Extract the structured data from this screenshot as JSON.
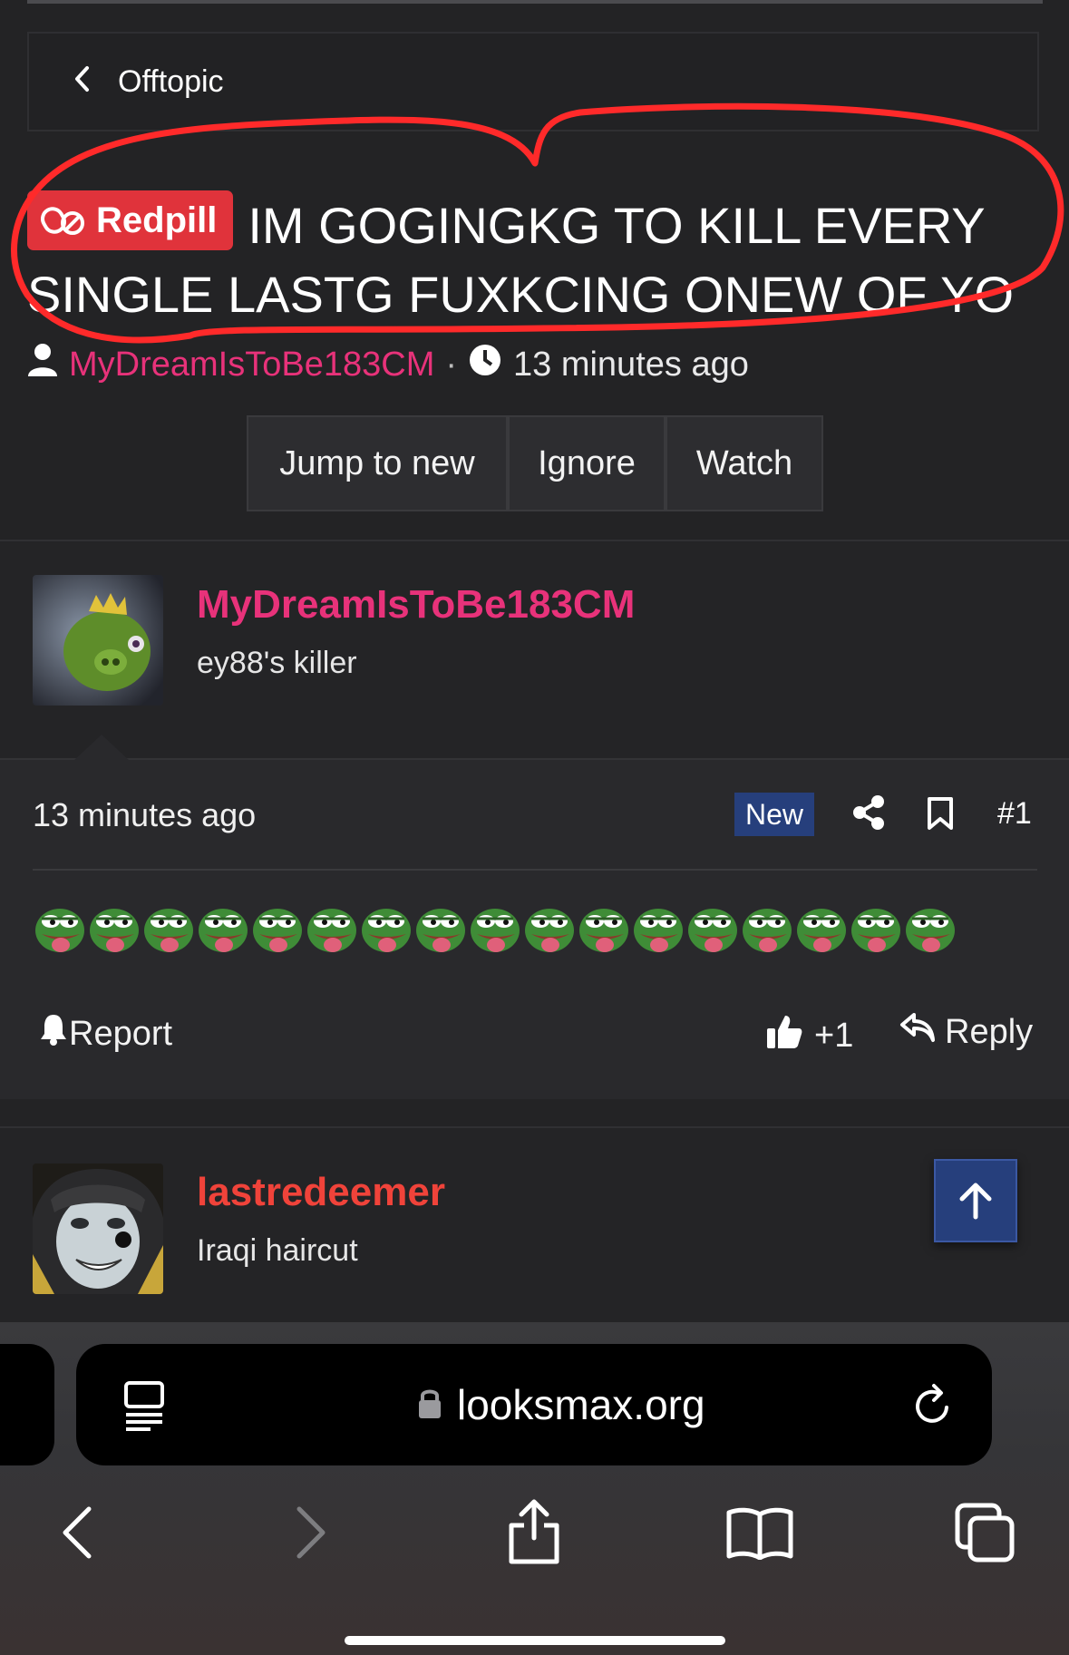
{
  "breadcrumb": {
    "label": "Offtopic"
  },
  "thread": {
    "prefix": "Redpill",
    "title": "IM GOGINGKG TO KILL EVERY SINGLE LASTG FUXKCING ONEW OF YO",
    "author": "MyDreamIsToBe183CM",
    "time": "13 minutes ago"
  },
  "actions": {
    "jump": "Jump to new",
    "ignore": "Ignore",
    "watch": "Watch"
  },
  "post1": {
    "username": "MyDreamIsToBe183CM",
    "user_title": "ey88's killer",
    "time": "13 minutes ago",
    "new_badge": "New",
    "post_number": "#1",
    "emoji_count": 17,
    "report": "Report",
    "like_count": "+1",
    "reply": "Reply"
  },
  "post2": {
    "username": "lastredeemer",
    "user_title": "Iraqi haircut"
  },
  "browser": {
    "url": "looksmax.org"
  },
  "colors": {
    "accent_pink": "#e8327a",
    "accent_red": "#e0333b",
    "badge_blue": "#263f7c",
    "user2_color": "#f0433a",
    "annotation_red": "#ff2a2a"
  },
  "icons": [
    "chevron-left-icon",
    "pills-icon",
    "user-icon",
    "clock-icon",
    "share-icon",
    "bookmark-icon",
    "bell-icon",
    "thumbs-up-icon",
    "reply-icon",
    "arrow-up-icon",
    "reader-icon",
    "lock-icon",
    "reload-icon",
    "back-icon",
    "forward-icon",
    "share-sheet-icon",
    "bookmarks-icon",
    "tabs-icon"
  ]
}
